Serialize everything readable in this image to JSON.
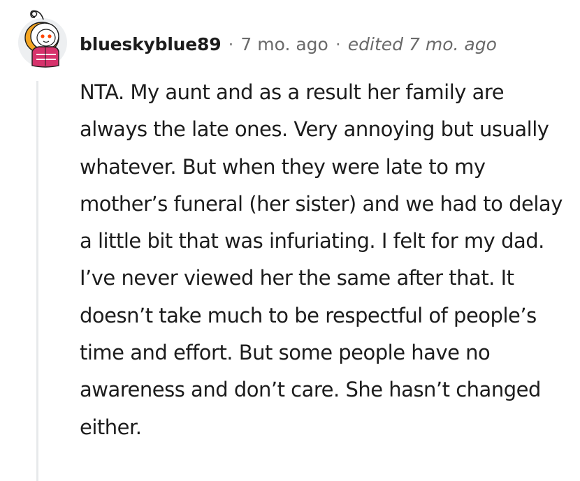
{
  "comment": {
    "author": "blueskyblue89",
    "separator": "·",
    "age": "7 mo. ago",
    "edited": "edited 7 mo. ago",
    "avatar_icon": "snoo-avatar-icon",
    "body": "NTA. My aunt and as a result her family are always the late ones. Very annoying but usually whatever. But when they were late to my mother’s funeral (her sister) and we had to delay a little bit that was infuriating. I felt for my dad. I’ve never viewed her the same after that. It doesn’t take much to be respectful of people’s time and effort. But some people have no awareness and don’t care. She hasn’t changed either."
  },
  "colors": {
    "thread_line": "#e7e9eb",
    "meta_text": "#6a6a6a",
    "avatar_accent": "#f5a623",
    "avatar_jacket": "#d6336c"
  }
}
